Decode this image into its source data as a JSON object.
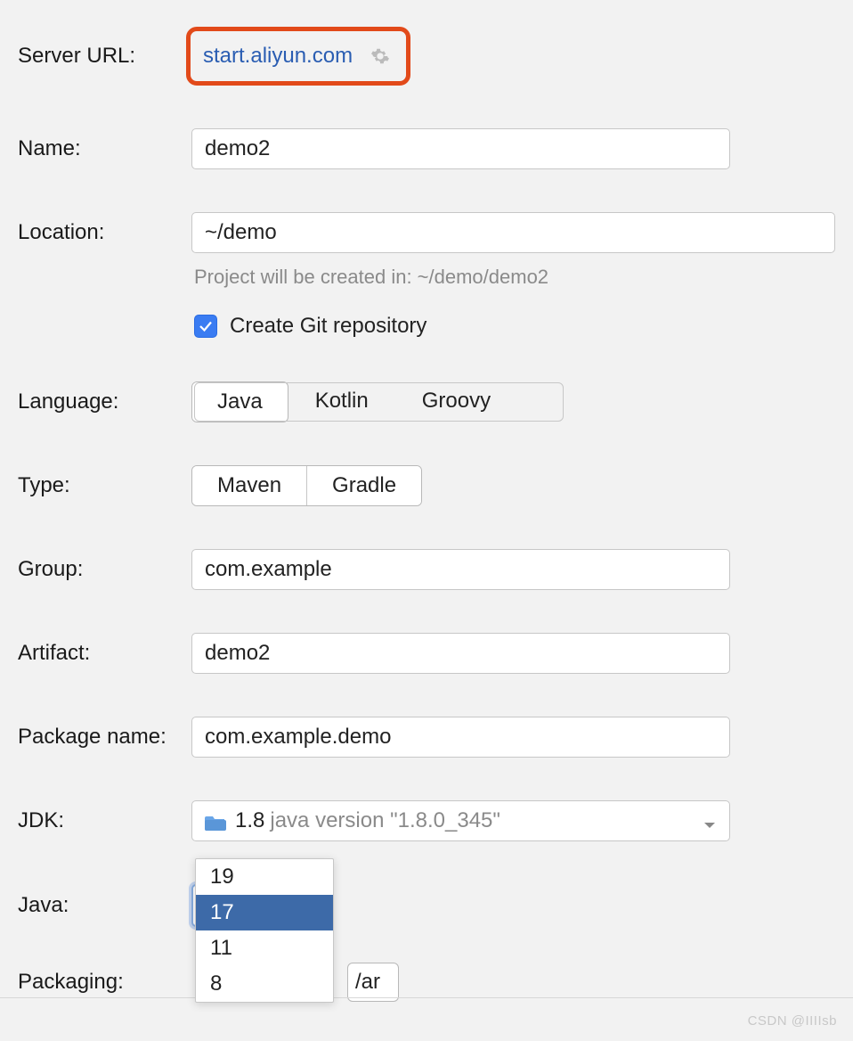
{
  "serverUrl": {
    "label": "Server URL:",
    "value": "start.aliyun.com"
  },
  "name": {
    "label": "Name:",
    "value": "demo2"
  },
  "location": {
    "label": "Location:",
    "value": "~/demo",
    "hint": "Project will be created in: ~/demo/demo2"
  },
  "git": {
    "checked": true,
    "label": "Create Git repository"
  },
  "language": {
    "label": "Language:",
    "options": [
      "Java",
      "Kotlin",
      "Groovy"
    ],
    "selected": "Java"
  },
  "type": {
    "label": "Type:",
    "options": [
      "Maven",
      "Gradle"
    ],
    "selected": "Maven"
  },
  "group": {
    "label": "Group:",
    "value": "com.example"
  },
  "artifact": {
    "label": "Artifact:",
    "value": "demo2"
  },
  "packageName": {
    "label": "Package name:",
    "value": "com.example.demo"
  },
  "jdk": {
    "label": "JDK:",
    "version": "1.8",
    "desc": "java version \"1.8.0_345\""
  },
  "java": {
    "label": "Java:",
    "selected": "17",
    "options": [
      "19",
      "17",
      "11",
      "8"
    ]
  },
  "packaging": {
    "label": "Packaging:",
    "visiblePartial": "/ar"
  },
  "watermark": "CSDN @IIIIsb"
}
